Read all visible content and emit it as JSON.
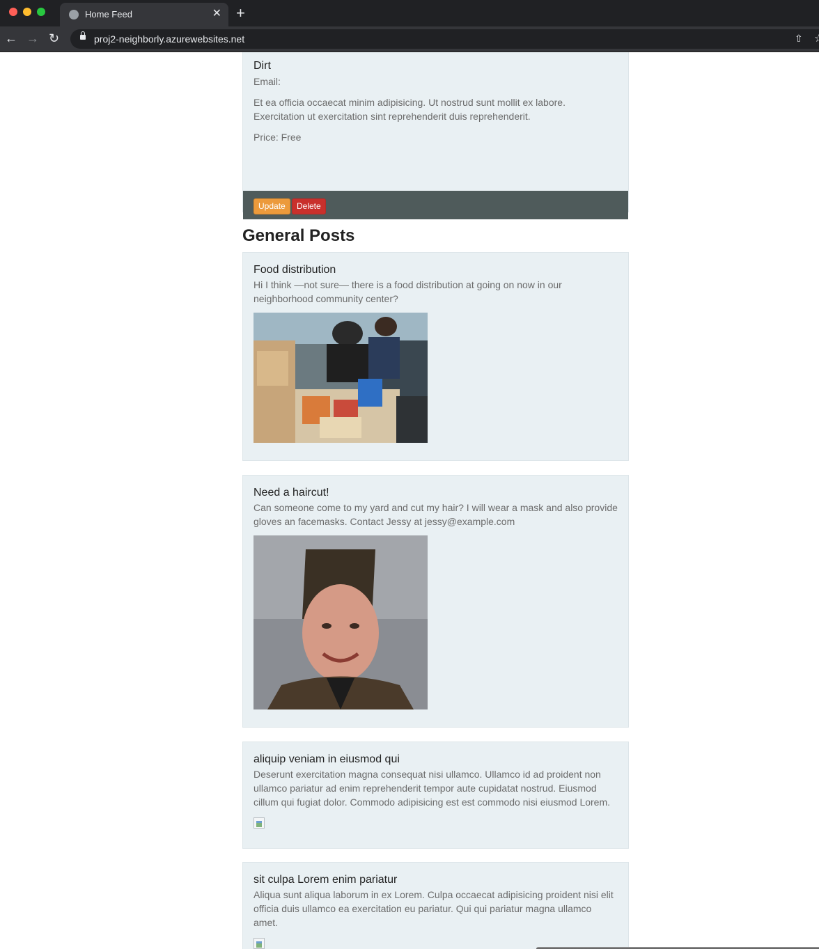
{
  "browser": {
    "tab_title": "Home Feed",
    "url": "proj2-neighborly.azurewebsites.net",
    "tab_close": "✕",
    "new_tab": "+",
    "back": "←",
    "forward": "→",
    "reload": "↻",
    "share": "⇧",
    "bookmark": "☆"
  },
  "top_card": {
    "title": "Dirt",
    "email_label": "Email:",
    "description": "Et ea officia occaecat minim adipisicing. Ut nostrud sunt mollit ex labore. Exercitation ut exercitation sint reprehenderit duis reprehenderit.",
    "price": "Price: Free",
    "update_label": "Update",
    "delete_label": "Delete"
  },
  "section_title": "General Posts",
  "posts": [
    {
      "title": "Food distribution",
      "body": "Hi I think —not sure— there is a food distribution at going on now in our neighborhood community center?"
    },
    {
      "title": "Need a haircut!",
      "body": "Can someone come to my yard and cut my hair? I will wear a mask and also provide gloves an facemasks. Contact Jessy at jessy@example.com"
    },
    {
      "title": "aliquip veniam in eiusmod qui",
      "body": "Deserunt exercitation magna consequat nisi ullamco. Ullamco id ad proident non ullamco pariatur ad enim reprehenderit tempor aute cupidatat nostrud. Eiusmod cillum qui fugiat dolor. Commodo adipisicing est est commodo nisi eiusmod Lorem."
    },
    {
      "title": "sit culpa Lorem enim pariatur",
      "body": "Aliqua sunt aliqua laborum in ex Lorem. Culpa occaecat adipisicing proident nisi elit officia duis ullamco ea exercitation eu pariatur. Qui qui pariatur magna ullamco amet."
    }
  ],
  "colors": {
    "card_bg": "#e9f0f3",
    "footer_bg": "#4f5b5b",
    "update_btn": "#ec9a3c",
    "delete_btn": "#c9302c"
  }
}
